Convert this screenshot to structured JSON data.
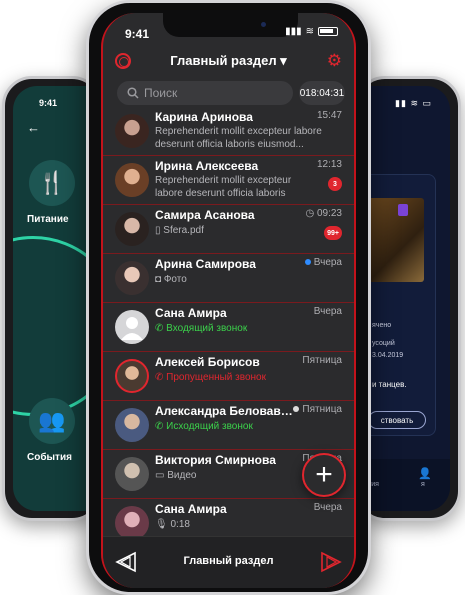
{
  "left_phone": {
    "time": "9:41",
    "items": [
      {
        "label": "Питание",
        "icon": "cutlery-icon"
      },
      {
        "label": "События",
        "icon": "people-icon"
      }
    ]
  },
  "right_phone": {
    "lines": [
      "ячено",
      "усоций",
      "3.04.2019",
      "и танцев."
    ],
    "button": "ствовать",
    "nav": [
      "тия",
      "я"
    ]
  },
  "status": {
    "time": "9:41"
  },
  "header": {
    "title": "Главный раздел ▾"
  },
  "search": {
    "placeholder": "Поиск"
  },
  "timer": "018:04:31",
  "chats": [
    {
      "name": "Карина Аринова",
      "meta": "15:47",
      "preview": "Reprehenderit mollit excepteur labore deserunt officia laboris eiusmod...",
      "avatar": "#8a6a5a"
    },
    {
      "name": "Ирина Алексеева",
      "meta": "12:13",
      "preview": "Reprehenderit mollit excepteur labore deserunt officia laboris eiusmod...",
      "badge": "3",
      "avatar": "#a7714f"
    },
    {
      "name": "Самира Асанова",
      "meta": "09:23",
      "preview": "Sfera.pdf",
      "badge": "99+",
      "avatar": "#5a4a44"
    },
    {
      "name": "Арина Самирова",
      "meta": "Вчера",
      "preview": "Фото",
      "avatar": "#7a6a6a"
    },
    {
      "name": "Сана Амира",
      "meta": "Вчера",
      "preview": "Входящий звонок",
      "avatar": "#d6d6d8"
    },
    {
      "name": "Алексей Борисов",
      "meta": "Пятница",
      "preview": "Пропущенный звонок",
      "avatar": "#9a6a52"
    },
    {
      "name": "Александра Беловавио...",
      "meta": "Пятница",
      "preview": "Исходящий звонок",
      "avatar": "#6a7aa0"
    },
    {
      "name": "Виктория Смирнова",
      "meta": "Пятница",
      "preview": "Видео",
      "avatar": "#8a8a8a"
    },
    {
      "name": "Сана Амира",
      "meta": "Вчера",
      "preview": "0:18",
      "avatar": "#7a5a68"
    }
  ],
  "bottom": {
    "label": "Главный раздел"
  },
  "colors": {
    "accent": "#e0262e",
    "background": "#2b2b2d",
    "green": "#3bd14b",
    "online": "#2f8cff"
  }
}
